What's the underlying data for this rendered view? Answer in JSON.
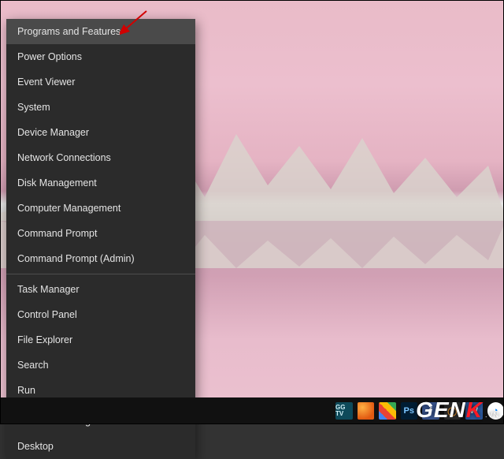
{
  "menu": {
    "groups": [
      [
        {
          "id": "programs-and-features",
          "label": "Programs and Features",
          "highlighted": true
        },
        {
          "id": "power-options",
          "label": "Power Options"
        },
        {
          "id": "event-viewer",
          "label": "Event Viewer"
        },
        {
          "id": "system",
          "label": "System"
        },
        {
          "id": "device-manager",
          "label": "Device Manager"
        },
        {
          "id": "network-connections",
          "label": "Network Connections"
        },
        {
          "id": "disk-management",
          "label": "Disk Management"
        },
        {
          "id": "computer-management",
          "label": "Computer Management"
        },
        {
          "id": "command-prompt",
          "label": "Command Prompt"
        },
        {
          "id": "command-prompt-admin",
          "label": "Command Prompt (Admin)"
        }
      ],
      [
        {
          "id": "task-manager",
          "label": "Task Manager"
        },
        {
          "id": "control-panel",
          "label": "Control Panel"
        },
        {
          "id": "file-explorer",
          "label": "File Explorer"
        },
        {
          "id": "search",
          "label": "Search"
        },
        {
          "id": "run",
          "label": "Run"
        }
      ],
      [
        {
          "id": "shut-down-or-sign-out",
          "label": "Shut down or sign out",
          "submenu": true
        },
        {
          "id": "desktop",
          "label": "Desktop"
        }
      ]
    ]
  },
  "taskbar": {
    "items": [
      {
        "id": "ggtv",
        "label": "GG TV"
      },
      {
        "id": "firefox",
        "label": "Firefox"
      },
      {
        "id": "chrome",
        "label": "Google Chrome"
      },
      {
        "id": "photoshop",
        "label": "Ps"
      },
      {
        "id": "facebook",
        "label": "f"
      },
      {
        "id": "octopus",
        "label": "◯"
      },
      {
        "id": "word",
        "label": "W"
      },
      {
        "id": "messenger",
        "label": "◔"
      }
    ]
  },
  "watermark": {
    "brand_prefix": "GEN",
    "brand_accent": "K",
    "suffix": ".VN"
  }
}
